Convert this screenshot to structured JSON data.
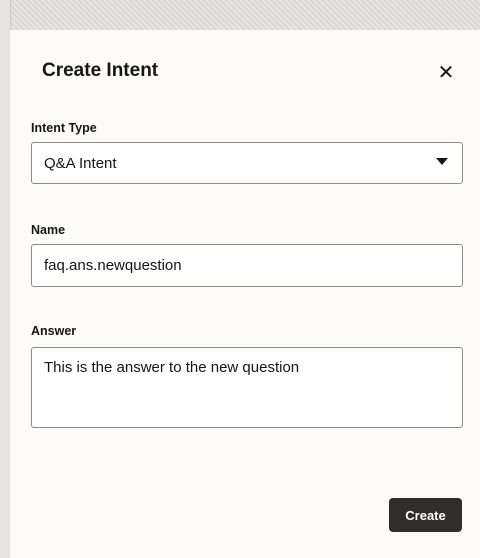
{
  "dialog": {
    "title": "Create Intent",
    "close_icon": "close-icon",
    "close_glyph": "✕"
  },
  "intent_type": {
    "label": "Intent Type",
    "selected": "Q&A Intent",
    "caret_icon": "chevron-down-icon"
  },
  "name": {
    "label": "Name",
    "value": "faq.ans.newquestion"
  },
  "answer": {
    "label": "Answer",
    "value": "This is the answer to the new question"
  },
  "actions": {
    "create_label": "Create"
  },
  "colors": {
    "primary_button": "#312d2a",
    "border": "#8f8c87",
    "background": "#fcfbfa"
  }
}
